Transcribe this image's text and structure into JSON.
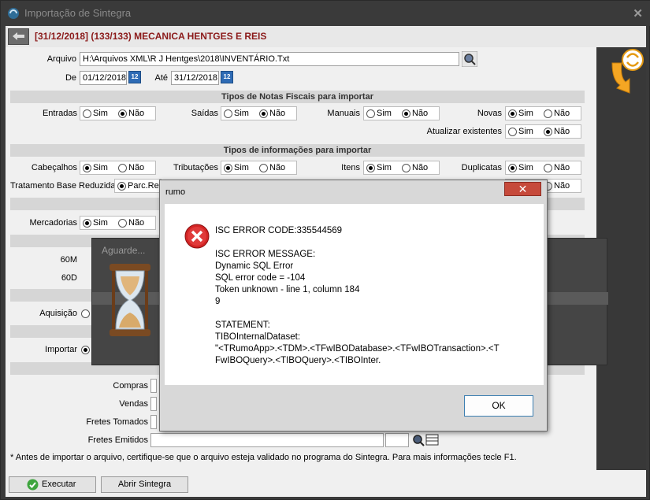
{
  "window": {
    "title": "Importação de Sintegra",
    "close_glyph": "✕"
  },
  "header": {
    "text": "[31/12/2018] (133/133) MECANICA HENTGES E REIS"
  },
  "file": {
    "label": "Arquivo",
    "value": "H:\\Arquivos XML\\R J Hentges\\2018\\INVENTÁRIO.Txt"
  },
  "dates": {
    "from_label": "De",
    "from_value": "01/12/2018",
    "to_label": "Até",
    "to_value": "31/12/2018",
    "cal_glyph": "12"
  },
  "section_nf": {
    "title": "Tipos de Notas Fiscais para importar"
  },
  "section_info": {
    "title": "Tipos de informações para importar"
  },
  "radio_yes": "Sim",
  "radio_no": "Não",
  "rows": {
    "entradas": "Entradas",
    "saidas": "Saídas",
    "manuais": "Manuais",
    "novas": "Novas",
    "atualizar": "Atualizar existentes",
    "cabecalhos": "Cabeçalhos",
    "tributacoes": "Tributações",
    "itens": "Itens",
    "duplicatas": "Duplicatas",
    "tratamento": "Tratamento Base Reduzida",
    "tratamento_value": "Parc.Re",
    "mercadorias": "Mercadorias",
    "m60": "60M",
    "d60": "60D",
    "aquisicao": "Aquisição",
    "importar": "Importar"
  },
  "lower": {
    "compras": "Compras",
    "vendas": "Vendas",
    "fretes_tomados": "Fretes Tomados",
    "fretes_emitidos": "Fretes Emitidos"
  },
  "note": "* Antes de importar o arquivo, certifique-se que o arquivo esteja validado no programa do Sintegra. Para mais informações tecle F1.",
  "buttons": {
    "execute": "Executar",
    "open_sintegra": "Abrir Sintegra"
  },
  "wait_dialog": {
    "title": "Aguarde..."
  },
  "error_dialog": {
    "title": "rumo",
    "close_glyph": "✕",
    "ok": "OK",
    "lines": [
      "ISC ERROR CODE:335544569",
      "",
      "ISC ERROR MESSAGE:",
      "Dynamic SQL Error",
      "SQL error code = -104",
      "Token unknown - line 1, column 184",
      "9",
      "",
      "STATEMENT:",
      "TIBOInternalDataset:",
      "\"<TRumoApp>.<TDM>.<TFwIBODatabase>.<TFwIBOTransaction>.<T",
      "FwIBOQuery>.<TIBOQuery>.<TIBOInter."
    ]
  }
}
